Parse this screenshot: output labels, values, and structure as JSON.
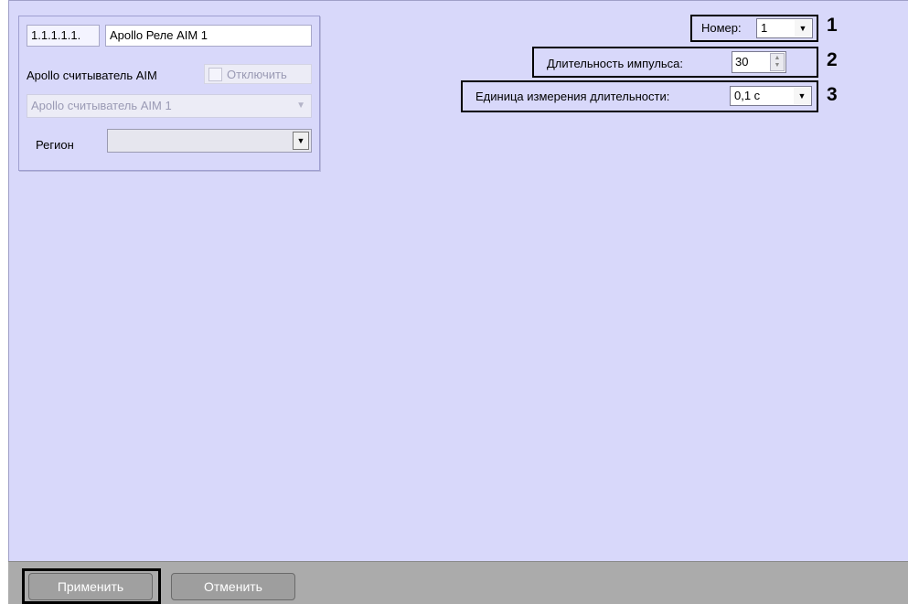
{
  "object": {
    "id_label": "1.1.1.1.1.",
    "name": "Apollo Реле AIM 1",
    "reader_label": "Apollo считыватель AIM",
    "disable_label": "Отключить",
    "reader_value": "Apollo считыватель AIM 1",
    "region_label": "Регион",
    "region_value": ""
  },
  "settings": {
    "number_label": "Номер:",
    "number_value": "1",
    "pulse_label": "Длительность импульса:",
    "pulse_value": "30",
    "unit_label": "Единица измерения длительности:",
    "unit_value": "0,1 с"
  },
  "markers": [
    "1",
    "2",
    "3"
  ],
  "footer": {
    "apply_label": "Применить",
    "cancel_label": "Отменить"
  },
  "colors": {
    "workspace": "#d8d8fa",
    "footer": "#ababab",
    "button": "#9e9e9e"
  }
}
